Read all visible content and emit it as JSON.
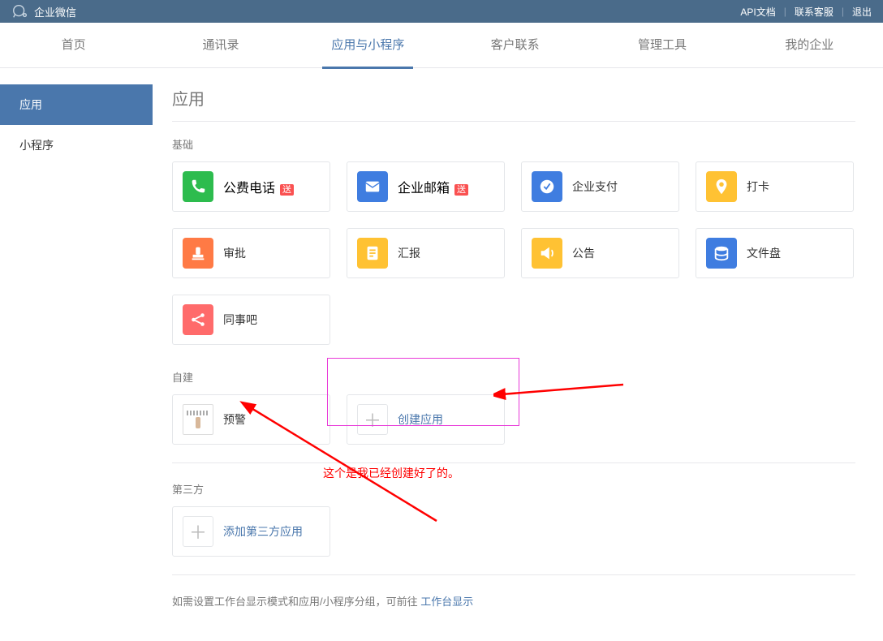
{
  "topbar": {
    "brand": "企业微信",
    "links": {
      "api": "API文档",
      "support": "联系客服",
      "logout": "退出"
    }
  },
  "nav": {
    "items": [
      "首页",
      "通讯录",
      "应用与小程序",
      "客户联系",
      "管理工具",
      "我的企业"
    ],
    "active_index": 2
  },
  "sidebar": {
    "items": [
      {
        "label": "应用",
        "active": true
      },
      {
        "label": "小程序",
        "active": false
      }
    ]
  },
  "page": {
    "title": "应用"
  },
  "sections": {
    "basic": {
      "label": "基础",
      "apps": [
        {
          "name": "公费电话",
          "color": "#2dbc4e",
          "icon": "phone",
          "badge": "送"
        },
        {
          "name": "企业邮箱",
          "color": "#3f7de0",
          "icon": "mail",
          "badge": "送"
        },
        {
          "name": "企业支付",
          "color": "#3f7de0",
          "icon": "pay",
          "badge": null
        },
        {
          "name": "打卡",
          "color": "#ffc233",
          "icon": "pin",
          "badge": null
        },
        {
          "name": "审批",
          "color": "#ff7a45",
          "icon": "stamp",
          "badge": null
        },
        {
          "name": "汇报",
          "color": "#ffc233",
          "icon": "report",
          "badge": null
        },
        {
          "name": "公告",
          "color": "#ffc233",
          "icon": "announce",
          "badge": null
        },
        {
          "name": "文件盘",
          "color": "#3f7de0",
          "icon": "disk",
          "badge": null
        },
        {
          "name": "同事吧",
          "color": "#ff6b6b",
          "icon": "share",
          "badge": null
        }
      ]
    },
    "custom": {
      "label": "自建",
      "apps": [
        {
          "name": "预警",
          "icon_type": "custom"
        }
      ],
      "create_label": "创建应用"
    },
    "thirdparty": {
      "label": "第三方",
      "add_label": "添加第三方应用"
    }
  },
  "footer": {
    "text_prefix": "如需设置工作台显示模式和应用/小程序分组，可前往 ",
    "link": "工作台显示"
  },
  "annotation": {
    "text": "这个是我已经创建好了的。"
  }
}
